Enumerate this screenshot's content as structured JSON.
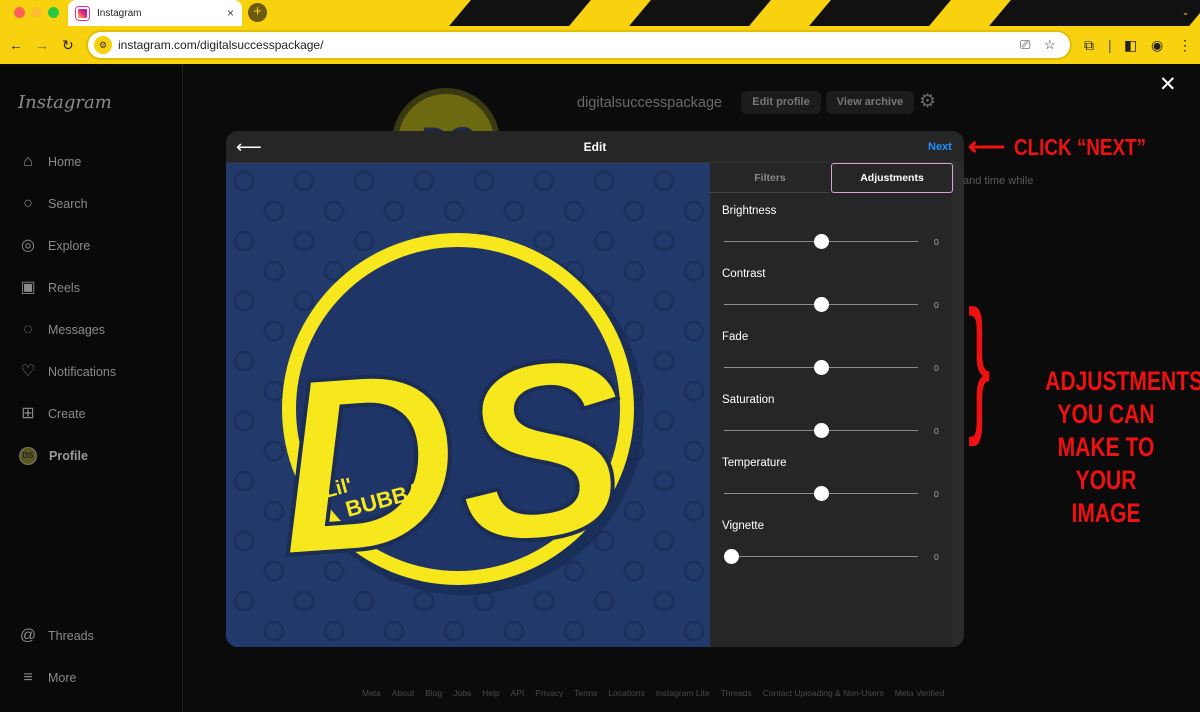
{
  "browser": {
    "tab_title": "Instagram",
    "tab_close": "×",
    "new_tab": "+",
    "url": "instagram.com/digitalsuccesspackage/",
    "tab_menu": "⌄"
  },
  "sidebar": {
    "logo": "Instagram",
    "items": [
      {
        "label": "Home",
        "icon": "⌂"
      },
      {
        "label": "Search",
        "icon": "○"
      },
      {
        "label": "Explore",
        "icon": "◎"
      },
      {
        "label": "Reels",
        "icon": "▣"
      },
      {
        "label": "Messages",
        "icon": "◌"
      },
      {
        "label": "Notifications",
        "icon": "♡"
      },
      {
        "label": "Create",
        "icon": "⊞"
      },
      {
        "label": "Profile",
        "icon": "DS"
      }
    ],
    "threads": {
      "label": "Threads",
      "icon": "@"
    },
    "more": {
      "label": "More",
      "icon": "≡"
    }
  },
  "profile": {
    "username": "digitalsuccesspackage",
    "edit_profile": "Edit profile",
    "view_archive": "View archive",
    "bio_fragment": "and time while",
    "avatar_text": "DS"
  },
  "modal": {
    "title": "Edit",
    "next": "Next",
    "tabs": {
      "filters": "Filters",
      "adjustments": "Adjustments"
    },
    "adjustments": [
      {
        "label": "Brightness",
        "value": "0",
        "level": 0.5
      },
      {
        "label": "Contrast",
        "value": "0",
        "level": 0.5
      },
      {
        "label": "Fade",
        "value": "0",
        "level": 0.5
      },
      {
        "label": "Saturation",
        "value": "0",
        "level": 0.5
      },
      {
        "label": "Temperature",
        "value": "0",
        "level": 0.5
      },
      {
        "label": "Vignette",
        "value": "0",
        "level": 0.0
      }
    ],
    "image": {
      "big_text": "DS",
      "small_text_1": "Lil'",
      "small_text_2": "BUBBA"
    }
  },
  "footer": [
    "Meta",
    "About",
    "Blog",
    "Jobs",
    "Help",
    "API",
    "Privacy",
    "Terms",
    "Locations",
    "Instagram Lite",
    "Threads",
    "Contact Uploading & Non-Users",
    "Meta Verified"
  ],
  "annotations": {
    "click_next": "CLICK “NEXT”",
    "adjust_lines": [
      "ADJUSTMENTS",
      "YOU CAN",
      "MAKE TO",
      "YOUR IMAGE"
    ],
    "brace": "}",
    "arrow": "⟵"
  },
  "colors": {
    "browser_theme": "#f8d20e",
    "accent_link": "#1e90ff",
    "annotation_red": "#ee1111",
    "logo_navy": "#22396b",
    "logo_yellow": "#f7e81e"
  }
}
